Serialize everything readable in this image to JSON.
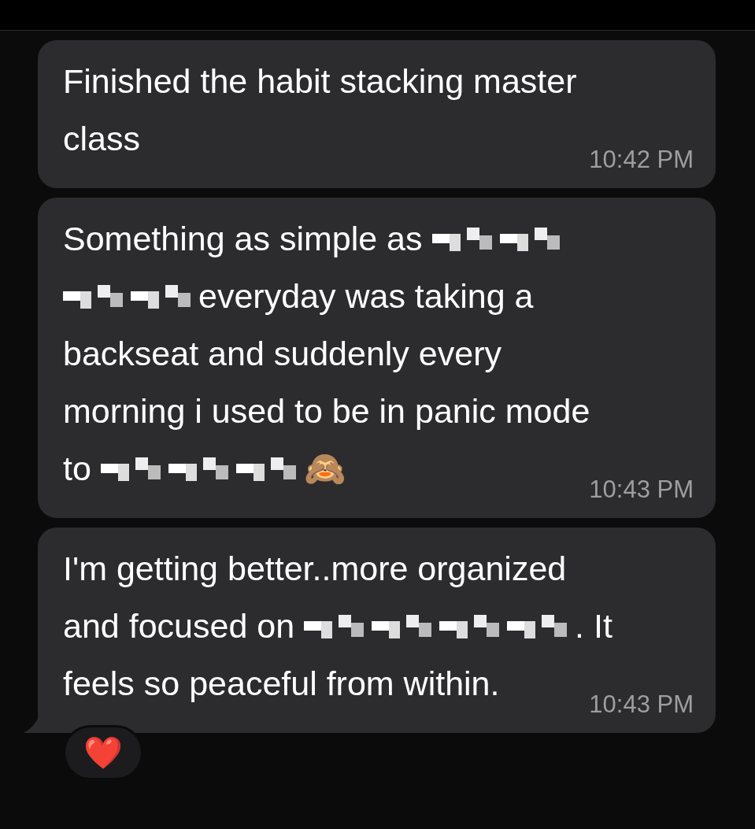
{
  "messages": [
    {
      "lines": [
        [
          {
            "kind": "text",
            "text": "Finished the habit stacking master"
          }
        ],
        [
          {
            "kind": "text",
            "text": "class"
          }
        ]
      ],
      "time": "10:42 PM",
      "tail": false
    },
    {
      "lines": [
        [
          {
            "kind": "text",
            "text": "Something as simple as"
          },
          {
            "kind": "redacted"
          },
          {
            "kind": "redacted"
          }
        ],
        [
          {
            "kind": "redacted"
          },
          {
            "kind": "redacted"
          },
          {
            "kind": "text",
            "text": "everyday was taking a"
          }
        ],
        [
          {
            "kind": "text",
            "text": "backseat and suddenly every"
          }
        ],
        [
          {
            "kind": "text",
            "text": "morning i used to be in panic mode"
          }
        ],
        [
          {
            "kind": "text",
            "text": "to"
          },
          {
            "kind": "redacted"
          },
          {
            "kind": "redacted"
          },
          {
            "kind": "redacted"
          },
          {
            "kind": "text",
            "text": "🙈"
          }
        ]
      ],
      "time": "10:43 PM",
      "tail": false
    },
    {
      "lines": [
        [
          {
            "kind": "text",
            "text": "I'm getting better..more organized"
          }
        ],
        [
          {
            "kind": "text",
            "text": "and focused on"
          },
          {
            "kind": "redacted"
          },
          {
            "kind": "redacted"
          },
          {
            "kind": "redacted"
          },
          {
            "kind": "redacted"
          },
          {
            "kind": "text",
            "text": ". It"
          }
        ],
        [
          {
            "kind": "text",
            "text": "feels so peaceful from within."
          }
        ]
      ],
      "time": "10:43 PM",
      "tail": true,
      "reaction": "❤️"
    }
  ]
}
